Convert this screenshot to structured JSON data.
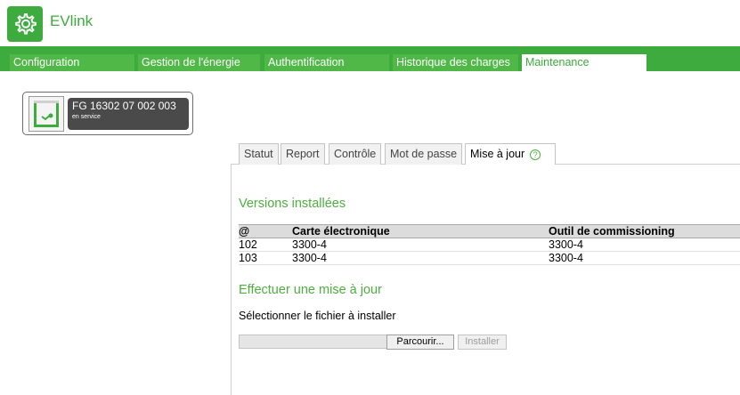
{
  "app": {
    "name": "EVlink",
    "logo_icon": "settings-gear-icon",
    "brand_color": "#3dab3d"
  },
  "main_tabs": [
    {
      "label": "Configuration",
      "active": false
    },
    {
      "label": "Gestion de l'énergie",
      "active": false
    },
    {
      "label": "Authentification",
      "active": false
    },
    {
      "label": "Historique des charges",
      "active": false
    },
    {
      "label": "Maintenance",
      "active": true
    }
  ],
  "station": {
    "id": "FG 16302 07 002 003",
    "status": "en service",
    "icon": "charging-station-icon"
  },
  "sub_tabs": [
    {
      "label": "Statut",
      "active": false
    },
    {
      "label": "Report",
      "active": false
    },
    {
      "label": "Contrôle",
      "active": false
    },
    {
      "label": "Mot de passe",
      "active": false
    },
    {
      "label": "Mise à jour",
      "active": true,
      "help_icon": "help-circle-icon"
    }
  ],
  "installed": {
    "title": "Versions installées",
    "columns": [
      "@",
      "Carte électronique",
      "Outil de commissioning"
    ],
    "rows": [
      [
        "102",
        "3300-4",
        "3300-4"
      ],
      [
        "103",
        "3300-4",
        "3300-4"
      ]
    ]
  },
  "update": {
    "title": "Effectuer une mise à jour",
    "select_label": "Sélectionner le fichier à installer",
    "file_value": "",
    "browse_label": "Parcourir...",
    "install_label": "Installer"
  }
}
